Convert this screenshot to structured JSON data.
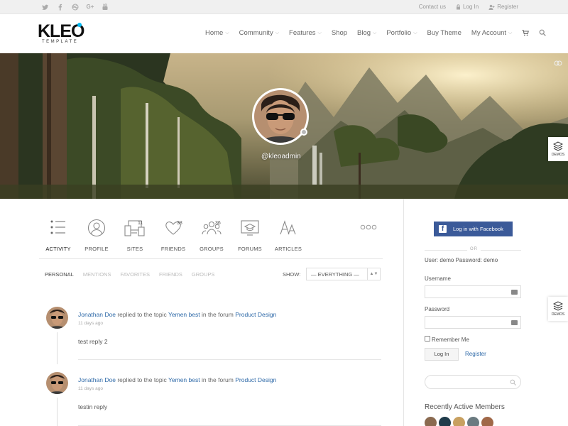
{
  "topbar": {
    "social_icons": [
      "twitter-icon",
      "facebook-icon",
      "dribbble-icon",
      "google-plus-icon",
      "youtube-icon"
    ],
    "contact": "Contact us",
    "login": "Log In",
    "register": "Register"
  },
  "logo": {
    "main": "KLEO",
    "sub": "TEMPLATE"
  },
  "nav": [
    {
      "label": "Home",
      "dropdown": true
    },
    {
      "label": "Community",
      "dropdown": true
    },
    {
      "label": "Features",
      "dropdown": true
    },
    {
      "label": "Shop",
      "dropdown": false
    },
    {
      "label": "Blog",
      "dropdown": true
    },
    {
      "label": "Portfolio",
      "dropdown": true
    },
    {
      "label": "Buy Theme",
      "dropdown": false
    },
    {
      "label": "My Account",
      "dropdown": true
    }
  ],
  "profile": {
    "handle": "@kleoadmin"
  },
  "demos_label": "DEMOS",
  "tabs": [
    {
      "label": "ACTIVITY",
      "icon": "activity-list-icon",
      "count": "",
      "active": true
    },
    {
      "label": "PROFILE",
      "icon": "profile-user-icon",
      "count": ""
    },
    {
      "label": "SITES",
      "icon": "sites-devices-icon",
      "count": "11"
    },
    {
      "label": "FRIENDS",
      "icon": "friends-heart-icon",
      "count": "38"
    },
    {
      "label": "GROUPS",
      "icon": "groups-people-icon",
      "count": "36"
    },
    {
      "label": "FORUMS",
      "icon": "forums-cap-icon",
      "count": ""
    },
    {
      "label": "ARTICLES",
      "icon": "articles-font-icon",
      "count": ""
    }
  ],
  "subnav": [
    "PERSONAL",
    "MENTIONS",
    "FAVORITES",
    "FRIENDS",
    "GROUPS"
  ],
  "filter": {
    "label": "SHOW:",
    "value": "— EVERYTHING —"
  },
  "activities": [
    {
      "user": "Jonathan Doe",
      "action": "replied to the topic",
      "topic": "Yemen best",
      "mid": "in the forum",
      "forum": "Product Design",
      "time": "11 days ago",
      "content": "test reply 2"
    },
    {
      "user": "Jonathan Doe",
      "action": "replied to the topic",
      "topic": "Yemen best",
      "mid": "in the forum",
      "forum": "Product Design",
      "time": "11 days ago",
      "content": "testin reply"
    }
  ],
  "sidebar": {
    "facebook_button": "Log in with Facebook",
    "or": "OR",
    "demo_credentials": "User: demo Password: demo",
    "username_label": "Username",
    "password_label": "Password",
    "remember": "Remember Me",
    "login_button": "Log In",
    "register_link": "Register",
    "recent_title": "Recently Active Members"
  },
  "colors": {
    "accent": "#00b9f2",
    "link": "#2f6aa8",
    "facebook": "#3b5a99"
  }
}
